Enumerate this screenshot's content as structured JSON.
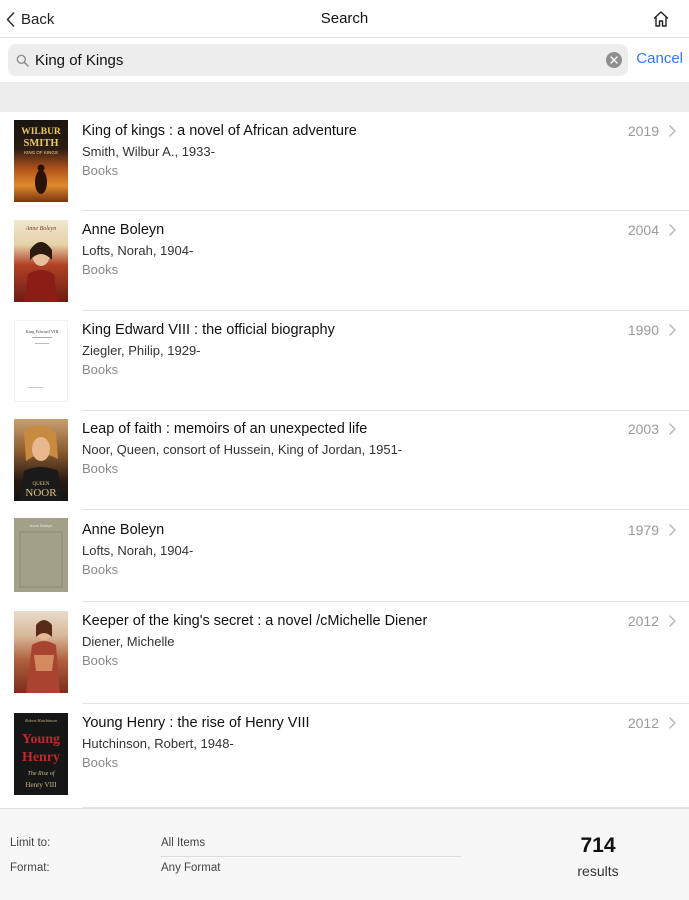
{
  "nav": {
    "back_label": "Back",
    "title": "Search",
    "home_icon": "home-icon",
    "back_icon": "chevron-left-icon"
  },
  "search": {
    "query": "King of Kings",
    "clear_icon": "clear-circle-icon",
    "cancel_label": "Cancel",
    "accent_color": "#3478f6"
  },
  "results": [
    {
      "title": "King of kings : a novel of African adventure",
      "author": "Smith, Wilbur A., 1933-",
      "format": "Books",
      "year": "2019",
      "cover_text": [
        "WILBUR",
        "SMITH",
        "KING OF KINGS"
      ]
    },
    {
      "title": "Anne Boleyn",
      "author": "Lofts, Norah, 1904-",
      "format": "Books",
      "year": "2004",
      "cover_text": [
        "Anne Boleyn"
      ]
    },
    {
      "title": "King Edward VIII : the official biography",
      "author": "Ziegler, Philip, 1929-",
      "format": "Books",
      "year": "1990",
      "cover_text": [
        "King Edward VIII"
      ]
    },
    {
      "title": "Leap of faith : memoirs of an unexpected life",
      "author": "Noor, Queen, consort of Hussein, King of Jordan, 1951-",
      "format": "Books",
      "year": "2003",
      "cover_text": [
        "QUEEN",
        "NOOR"
      ]
    },
    {
      "title": "Anne Boleyn",
      "author": "Lofts, Norah, 1904-",
      "format": "Books",
      "year": "1979",
      "cover_text": [
        "Anne Boleyn"
      ]
    },
    {
      "title": "Keeper of the king's secret : a novel /cMichelle Diener",
      "author": "Diener, Michelle",
      "format": "Books",
      "year": "2012",
      "cover_text": []
    },
    {
      "title": "Young Henry : the rise of Henry VIII",
      "author": "Hutchinson, Robert, 1948-",
      "format": "Books",
      "year": "2012",
      "cover_text": [
        "Robert Hutchinson",
        "Young",
        "Henry",
        "The Rise of",
        "Henry VIII"
      ]
    }
  ],
  "footer": {
    "limit_label": "Limit to:",
    "limit_value": "All Items",
    "format_label": "Format:",
    "format_value": "Any Format",
    "count": "714",
    "count_label": "results"
  }
}
